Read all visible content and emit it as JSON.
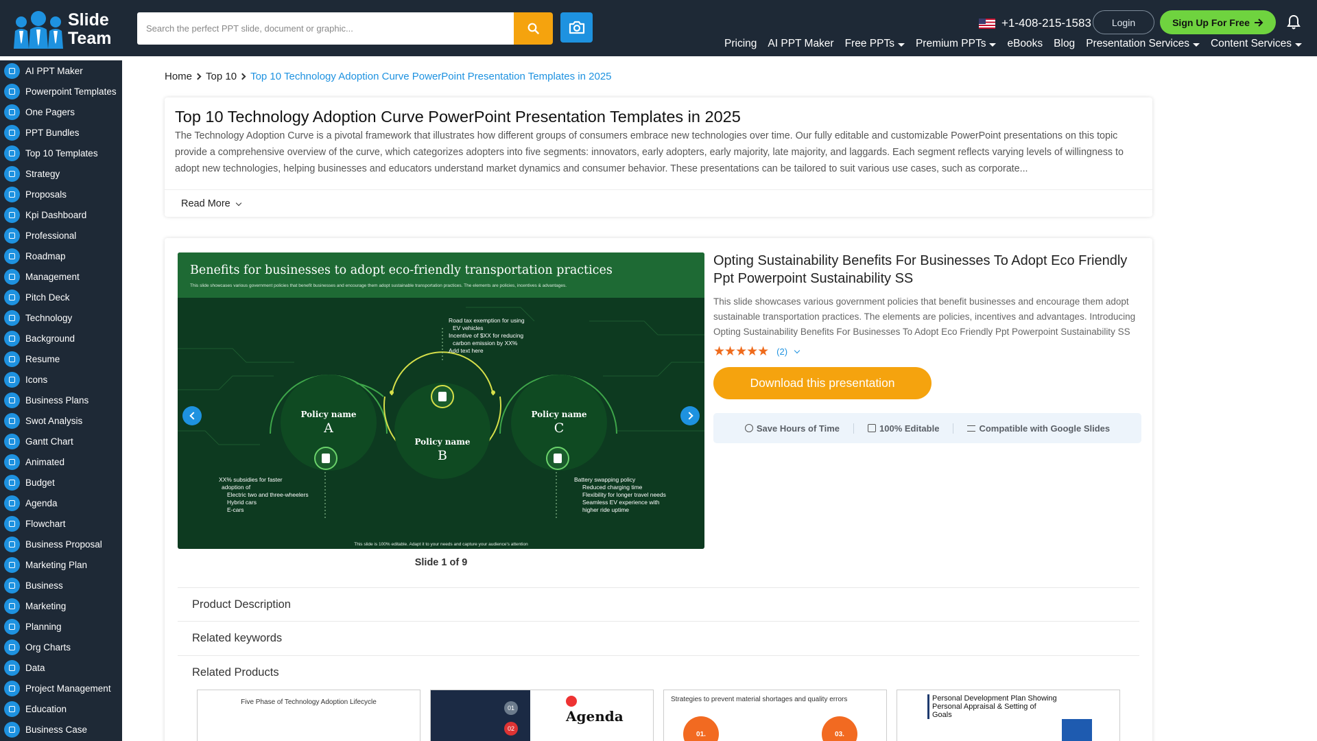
{
  "header": {
    "logo_line1": "Slide",
    "logo_line2": "Team",
    "search_placeholder": "Search the perfect PPT slide, document or graphic...",
    "phone": "+1-408-215-1583",
    "login": "Login",
    "signup": "Sign Up For Free",
    "nav": [
      {
        "label": "Pricing",
        "dropdown": false
      },
      {
        "label": "AI PPT Maker",
        "dropdown": false
      },
      {
        "label": "Free PPTs",
        "dropdown": true
      },
      {
        "label": "Premium PPTs",
        "dropdown": true
      },
      {
        "label": "eBooks",
        "dropdown": false
      },
      {
        "label": "Blog",
        "dropdown": false
      },
      {
        "label": "Presentation Services",
        "dropdown": true
      },
      {
        "label": "Content Services",
        "dropdown": true
      }
    ]
  },
  "sidebar": {
    "items": [
      "AI PPT Maker",
      "Powerpoint Templates",
      "One Pagers",
      "PPT Bundles",
      "Top 10 Templates",
      "Strategy",
      "Proposals",
      "Kpi Dashboard",
      "Professional",
      "Roadmap",
      "Management",
      "Pitch Deck",
      "Technology",
      "Background",
      "Resume",
      "Icons",
      "Business Plans",
      "Swot Analysis",
      "Gantt Chart",
      "Animated",
      "Budget",
      "Agenda",
      "Flowchart",
      "Business Proposal",
      "Marketing Plan",
      "Business",
      "Marketing",
      "Planning",
      "Org Charts",
      "Data",
      "Project Management",
      "Education",
      "Business Case"
    ]
  },
  "breadcrumb": {
    "home": "Home",
    "top10": "Top 10",
    "current": "Top 10 Technology Adoption Curve PowerPoint Presentation Templates in 2025"
  },
  "intro": {
    "title": "Top 10 Technology Adoption Curve PowerPoint Presentation Templates in 2025",
    "description": "The Technology Adoption Curve is a pivotal framework that illustrates how different groups of consumers embrace new technologies over time. Our fully editable and customizable PowerPoint presentations on this topic provide a comprehensive overview of the curve, which categorizes adopters into five segments: innovators, early adopters, early majority, late majority, and laggards. Each segment reflects varying levels of willingness to adopt new technologies, helping businesses and educators understand market dynamics and consumer behavior. These presentations can be tailored to suit various use cases, such as corporate...",
    "read_more": "Read More"
  },
  "slide": {
    "title": "Benefits for businesses to adopt eco-friendly transportation practices",
    "subtitle": "This slide showcases various government policies that benefit businesses and encourage them adopt sustainable transportation practices. The elements are policies, incentives & advantages.",
    "policy_name": "Policy name",
    "letters": [
      "A",
      "B",
      "C"
    ],
    "list_top": [
      "Road tax exemption for using",
      "EV vehicles",
      "Incentive of $XX for reducing",
      "carbon emission by XX%",
      "Add text here"
    ],
    "list_left": [
      "XX% subsidies for faster",
      "adoption of",
      "Electric two and three-wheelers",
      "Hybrid cars",
      "E-cars"
    ],
    "list_right": [
      "Battery swapping policy",
      "Reduced charging time",
      "Flexibility for longer travel needs",
      "Seamless EV experience with",
      "higher ride uptime"
    ],
    "footer": "This slide is 100% editable. Adapt it to your needs and capture your audience's attention",
    "counter": "Slide 1 of 9"
  },
  "product": {
    "title": "Opting Sustainability Benefits For Businesses To Adopt Eco Friendly Ppt Powerpoint Sustainability SS",
    "description": "This slide showcases various government policies that benefit businesses and encourage them adopt sustainable transportation practices. The elements are policies, incentives and advantages. Introducing Opting Sustainability Benefits For Businesses To Adopt Eco Friendly Ppt Powerpoint Sustainability SS t...",
    "stars": "★★★★★",
    "rating_count": "(2)",
    "rating_value": 5,
    "download": "Download this presentation",
    "features": [
      "Save Hours of Time",
      "100% Editable",
      "Compatible with Google Slides"
    ]
  },
  "accordion": {
    "description": "Product Description",
    "keywords": "Related keywords",
    "related": "Related Products"
  },
  "related_thumbs": [
    {
      "title": "Five Phase of Technology Adoption Lifecycle"
    },
    {
      "title": "Agenda",
      "badges": [
        "01",
        "02"
      ]
    },
    {
      "title": "Strategies to prevent material shortages and quality errors",
      "badges": [
        "01.",
        "03."
      ]
    },
    {
      "title": "Personal Development Plan Showing Personal Appraisal & Setting of Goals"
    }
  ],
  "colors": {
    "header_bg": "#1e2936",
    "accent_blue": "#1e92e0",
    "accent_orange": "#f5a30e",
    "signup_green": "#6fd33f",
    "star_color": "#ef6b1c"
  }
}
